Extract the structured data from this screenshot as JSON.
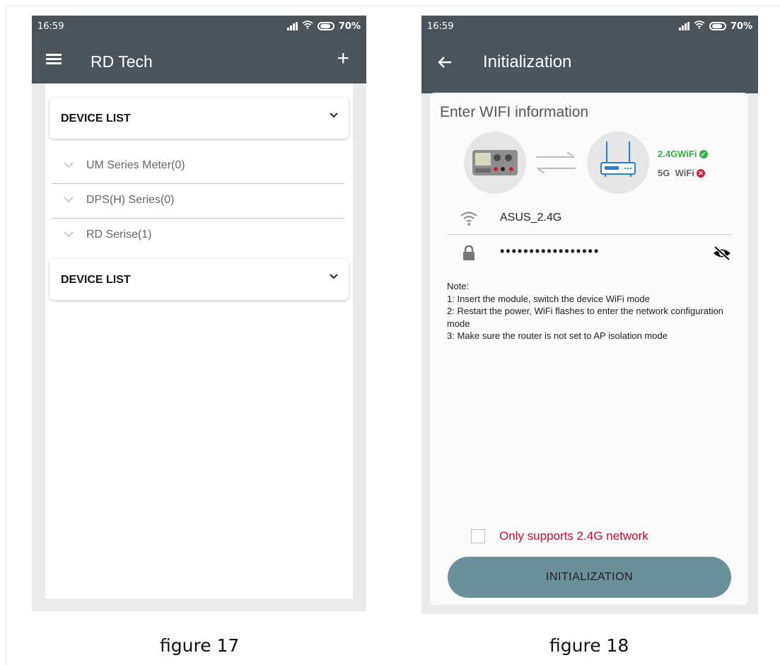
{
  "figure17": {
    "status_time": "16:59",
    "battery": "70%",
    "app_title": "RD Tech",
    "device_list_header_1": "DEVICE LIST",
    "device_list_header_2": "DEVICE LIST",
    "series": [
      {
        "label": "UM Series Meter(0)"
      },
      {
        "label": "DPS(H) Series(0)"
      },
      {
        "label": "RD Serise(1)"
      }
    ],
    "caption": "figure 17"
  },
  "figure18": {
    "status_time": "16:59",
    "battery": "70%",
    "app_title": "Initialization",
    "card_title": "Enter WIFI information",
    "wifi_24_label": "2.4GWiFi",
    "wifi_5_label": "5G  WiFi",
    "ssid_value": "ASUS_2.4G",
    "password_mask": "•••••••••••••••••",
    "note_text": "Note:\n1: Insert the module, switch the device WiFi mode\n2: Restart the power, WiFi flashes to enter the network configuration mode\n3: Make sure the router is not set to AP isolation mode",
    "checkbox_label": "Only supports 2.4G network",
    "checkbox_checked": false,
    "button_label": "INITIALIZATION",
    "caption": "figure 18"
  },
  "colors": {
    "appbar": "#4b545b",
    "wifi_ok": "#33b24a",
    "wifi_bad": "#d01e2e",
    "warning_text": "#c8102e",
    "button": "#6a9099"
  }
}
